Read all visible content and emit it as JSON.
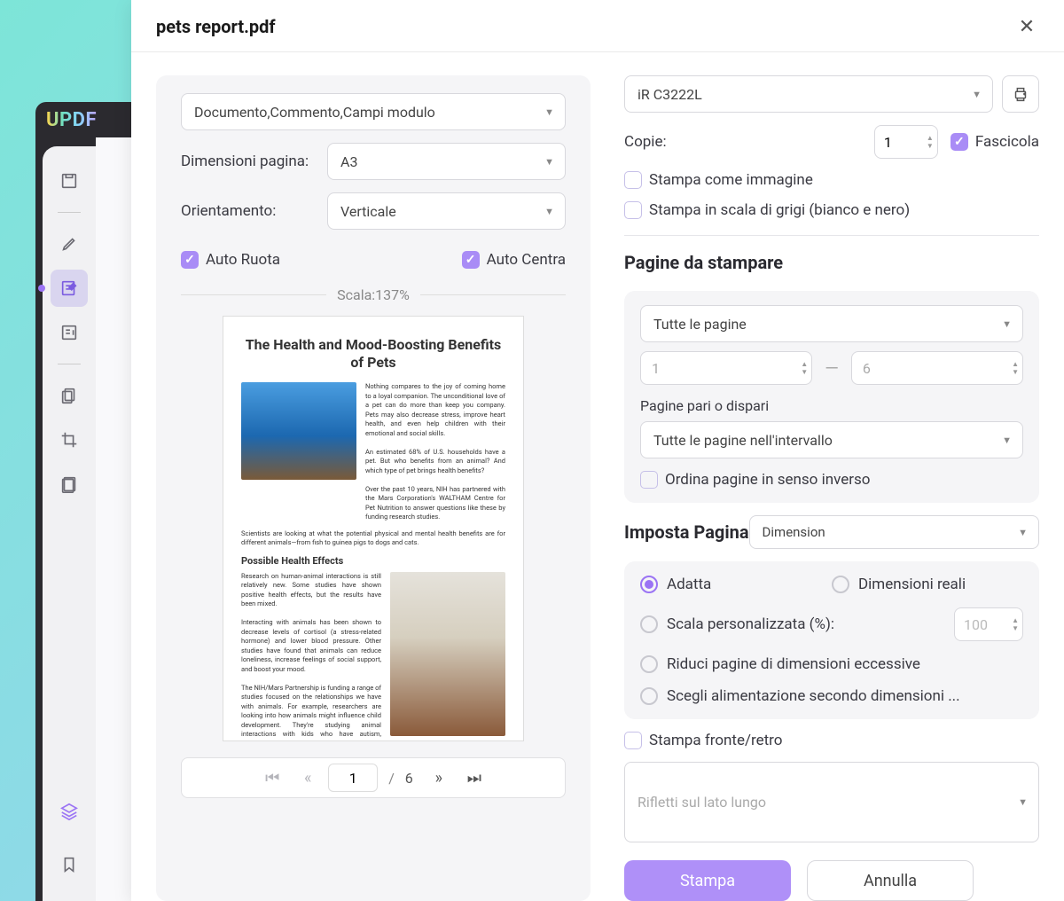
{
  "app": {
    "logo": "UPDF"
  },
  "dialog": {
    "title": "pets report.pdf",
    "preview": {
      "content_select": "Documento,Commento,Campi modulo",
      "page_size_label": "Dimensioni pagina:",
      "page_size_value": "A3",
      "orientation_label": "Orientamento:",
      "orientation_value": "Verticale",
      "auto_rotate": "Auto Ruota",
      "auto_center": "Auto Centra",
      "scale_text": "Scala:137%",
      "doc_title": "The Health and Mood-Boosting Benefits of Pets",
      "para1": "Nothing compares to the joy of coming home to a loyal companion. The unconditional love of a pet can do more than keep you company. Pets may also decrease stress, improve heart health, and even help children with their emotional and social skills.",
      "para2": "An estimated 68% of U.S. households have a pet. But who benefits from an animal? And which type of pet brings health benefits?",
      "para3": "Over the past 10 years, NIH has partnered with the Mars Corporation's WALTHAM Centre for Pet Nutrition to answer questions like these by funding research studies.",
      "para4": "Scientists are looking at what the potential physical and mental health benefits are for different animals—from fish to guinea pigs to dogs and cats.",
      "subhead": "Possible Health Effects",
      "para5": "Research on human-animal interactions is still relatively new. Some studies have shown positive health effects, but the results have been mixed.",
      "para6": "Interacting with animals has been shown to decrease levels of cortisol (a stress-related hormone) and lower blood pressure. Other studies have found that animals can reduce loneliness, increase feelings of social support, and boost your mood.",
      "para7": "The NIH/Mars Partnership is funding a range of studies focused on the relationships we have with animals. For example, researchers are looking into how animals might influence child development. They're studying animal interactions with kids who have autism, attention deficit hyperactivity disorder (ADHD), and other conditions.",
      "pager": {
        "current": "1",
        "total": "6"
      }
    },
    "settings": {
      "printer": "iR C3222L",
      "copies_label": "Copie:",
      "copies_value": "1",
      "collate": "Fascicola",
      "print_as_image": "Stampa come immagine",
      "grayscale": "Stampa in scala di grigi (bianco e nero)",
      "pages_section": "Pagine da stampare",
      "page_range_select": "Tutte le pagine",
      "range_from": "1",
      "range_to": "6",
      "odd_even_label": "Pagine pari o dispari",
      "odd_even_value": "Tutte le pagine nell'intervallo",
      "reverse": "Ordina pagine in senso inverso",
      "imposta_title": "Imposta Pagina",
      "dim_select": "Dimension",
      "radio_fit": "Adatta",
      "radio_actual": "Dimensioni reali",
      "radio_custom": "Scala personalizzata (%):",
      "custom_value": "100",
      "radio_shrink": "Riduci pagine di dimensioni eccessive",
      "radio_choose": "Scegli alimentazione secondo dimensioni ...",
      "duplex": "Stampa fronte/retro",
      "flip_value": "Rifletti sul lato lungo",
      "btn_print": "Stampa",
      "btn_cancel": "Annulla"
    }
  }
}
